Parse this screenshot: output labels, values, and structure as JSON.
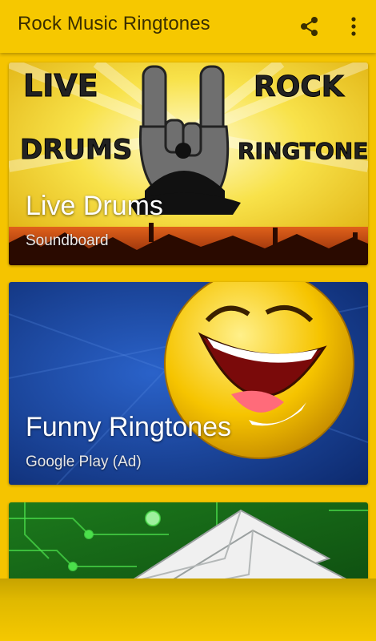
{
  "appbar": {
    "title": "Rock Music Ringtones",
    "share_icon": "share-icon",
    "more_icon": "more-vert-icon"
  },
  "cards": [
    {
      "title": "Live Drums",
      "subtitle": "Soundboard",
      "art_text": [
        "LIVE",
        "ROCK",
        "DRUMS",
        "RINGTONES"
      ]
    },
    {
      "title": "Funny Ringtones",
      "subtitle": "Google Play (Ad)"
    },
    {
      "title": "",
      "subtitle": ""
    }
  ],
  "colors": {
    "appbar": "#f6c800",
    "background": "#f5c400",
    "title_text": "#3a2e00"
  }
}
